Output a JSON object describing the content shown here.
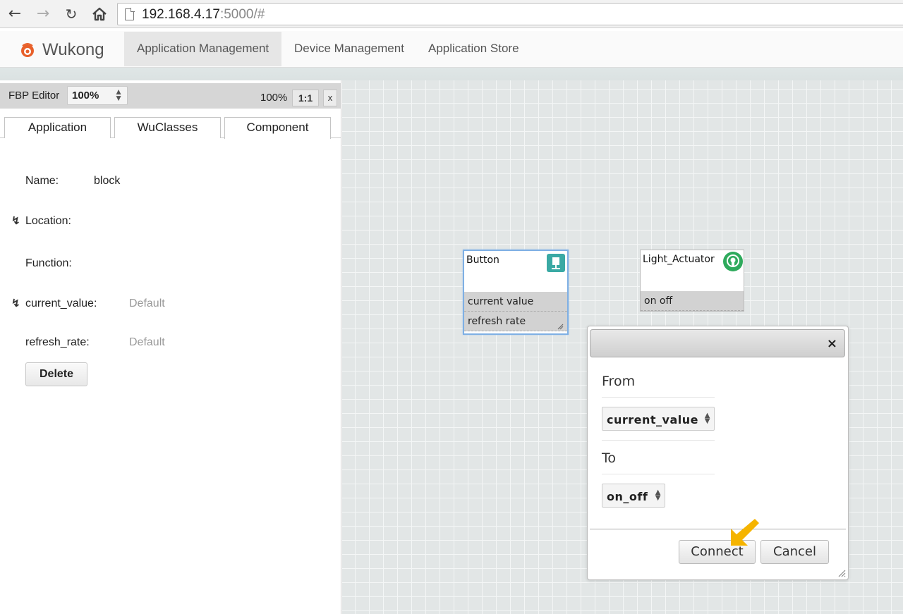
{
  "browser": {
    "url_host": "192.168.4.17",
    "url_rest": ":5000/#"
  },
  "app": {
    "brand": "Wukong",
    "tabs": [
      "Application Management",
      "Device Management",
      "Application Store"
    ]
  },
  "editor": {
    "title": "FBP Editor",
    "zoom_select": "100%",
    "zoom_label": "100%",
    "one_to_one": "1:1",
    "close": "x",
    "tabs": [
      "Application",
      "WuClasses",
      "Component"
    ]
  },
  "component": {
    "name_label": "Name:",
    "name_value": "block",
    "location_label": "Location:",
    "function_label": "Function:",
    "current_value_label": "current_value:",
    "current_value_default": "Default",
    "refresh_rate_label": "refresh_rate:",
    "refresh_rate_default": "Default",
    "delete_label": "Delete"
  },
  "canvas": {
    "nodes": [
      {
        "title": "Button",
        "props": [
          "current value",
          "refresh rate"
        ],
        "icon": "button-icon"
      },
      {
        "title": "Light_Actuator",
        "props": [
          "on off"
        ],
        "icon": "light-bulb-icon"
      }
    ]
  },
  "dialog": {
    "close": "×",
    "from_label": "From",
    "from_value": "current_value",
    "to_label": "To",
    "to_value": "on_off",
    "connect_label": "Connect",
    "cancel_label": "Cancel"
  },
  "colors": {
    "button_icon": "#3aa9a4",
    "light_icon": "#2eaa5c",
    "pointer_arrow": "#f5b400",
    "brand_icon": "#e8602a"
  }
}
